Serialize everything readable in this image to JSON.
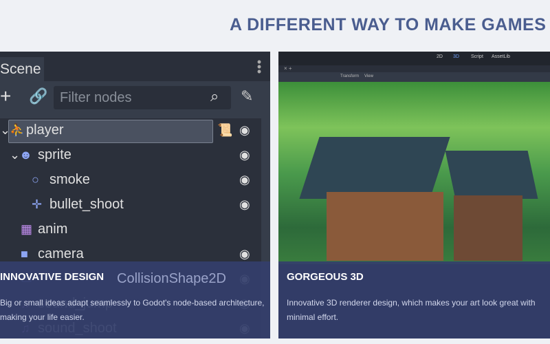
{
  "heading": "A DIFFERENT WAY TO MAKE GAMES",
  "left_card": {
    "scene_tab": "Scene",
    "filter_placeholder": "Filter nodes",
    "nodes": [
      {
        "name": "player",
        "icon": "kinematic-body-icon",
        "selected": true
      },
      {
        "name": "sprite",
        "icon": "sprite-icon"
      },
      {
        "name": "smoke",
        "icon": "particles-icon"
      },
      {
        "name": "bullet_shoot",
        "icon": "position-icon"
      },
      {
        "name": "anim",
        "icon": "animation-player-icon"
      },
      {
        "name": "camera",
        "icon": "camera-icon"
      },
      {
        "name": "CollisionShape2D",
        "icon": "collision-shape-icon"
      },
      {
        "name": "sound_jump",
        "icon": "audio-icon"
      },
      {
        "name": "sound_shoot",
        "icon": "audio-icon"
      }
    ],
    "title": "INNOVATIVE DESIGN",
    "text": "Big or small ideas adapt seamlessly to Godot's node-based architecture, making your life easier."
  },
  "right_card": {
    "workspaces": [
      "2D",
      "3D",
      "Script",
      "AssetLib"
    ],
    "menus": [
      "Transform",
      "View"
    ],
    "title": "GORGEOUS 3D",
    "text": "Innovative 3D renderer design, which makes your art look great with minimal effort."
  }
}
